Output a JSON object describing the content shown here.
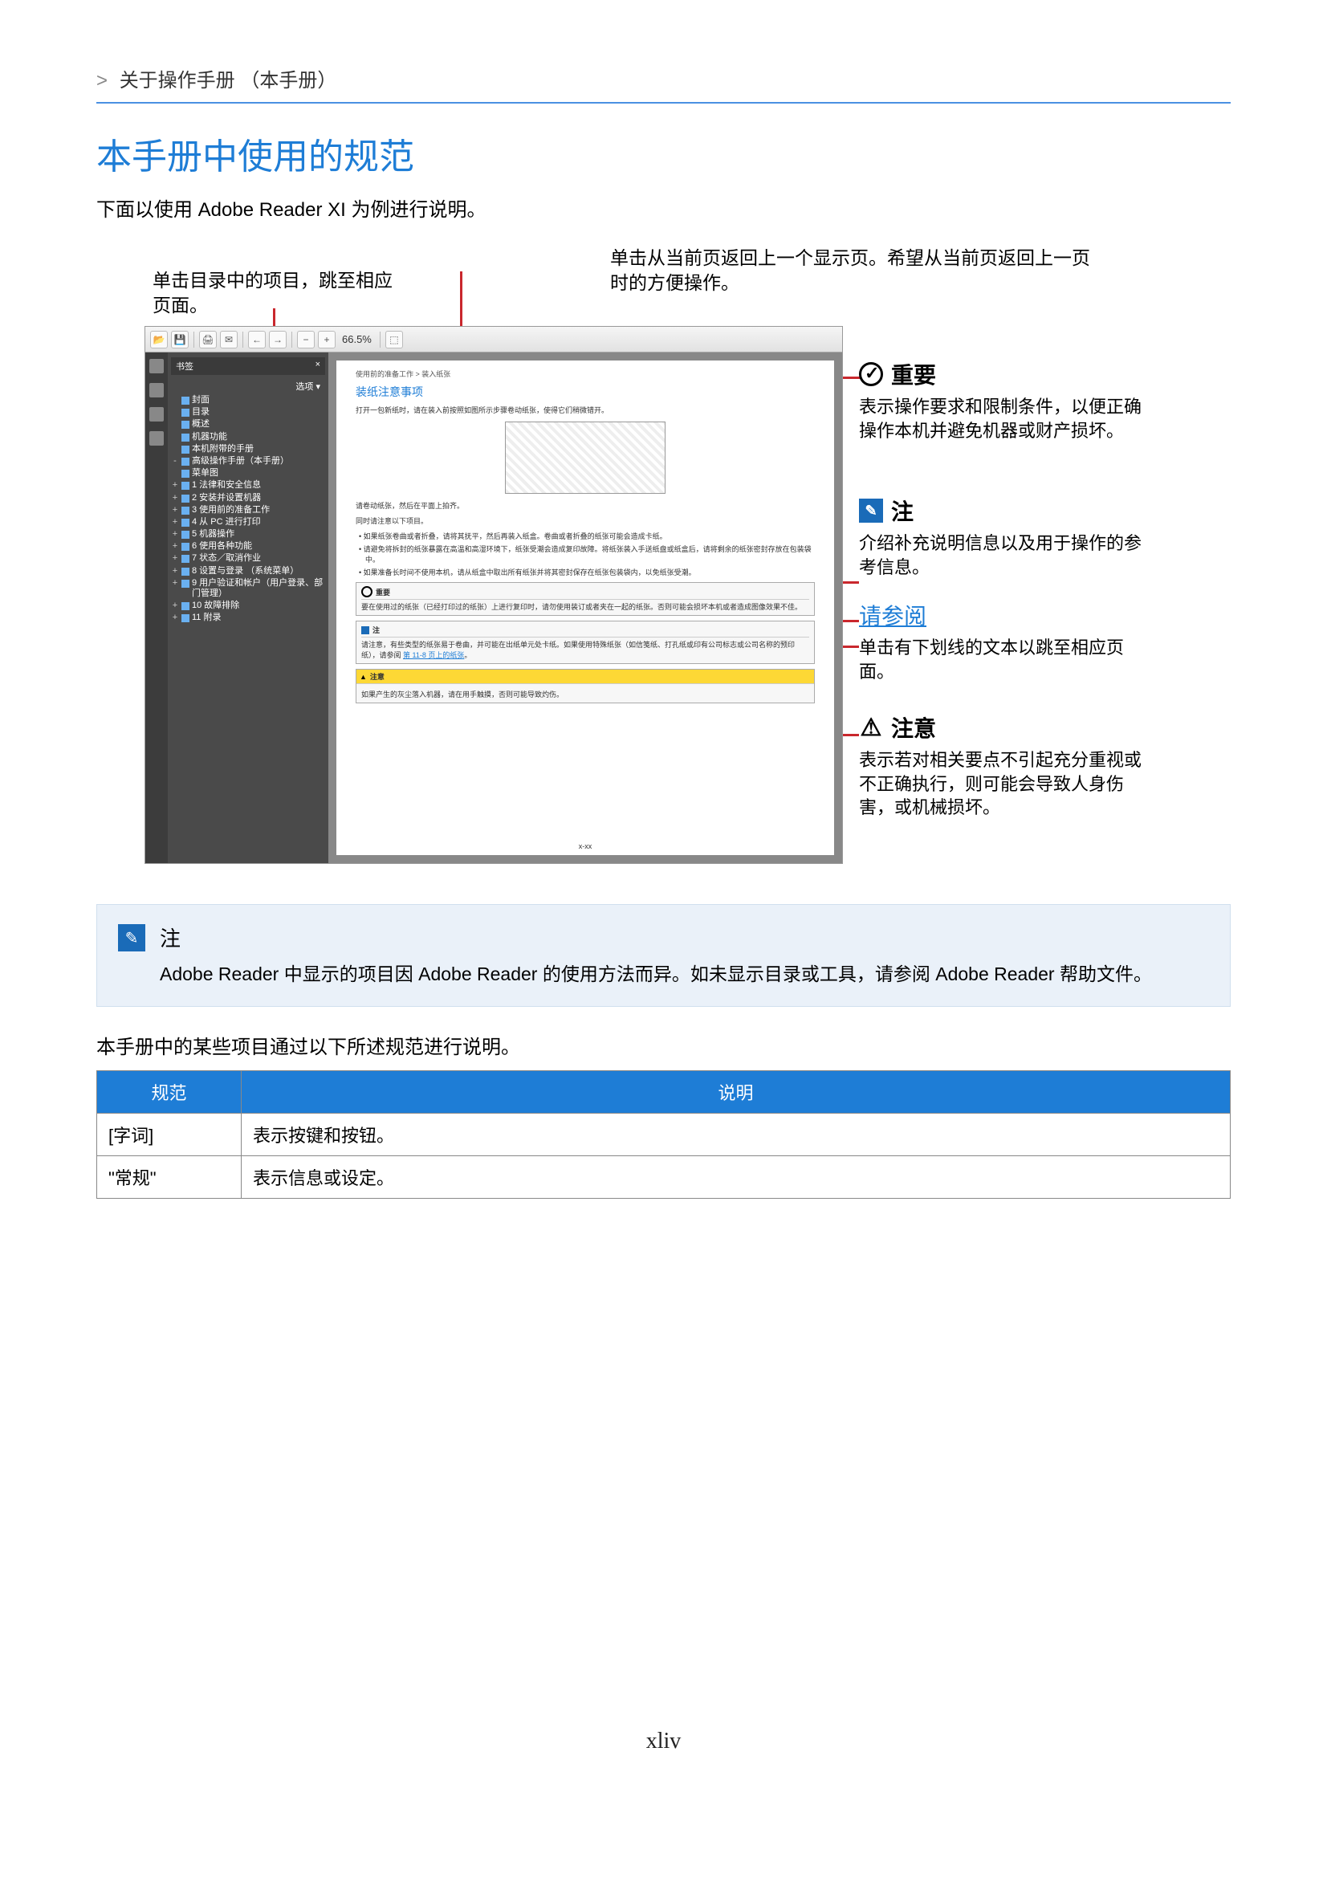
{
  "breadcrumb": {
    "caret": ">",
    "text": "关于操作手册 （本手册）"
  },
  "title": "本手册中使用的规范",
  "intro": "下面以使用 Adobe Reader XI 为例进行说明。",
  "callouts": {
    "left_top": "单击目录中的项目，跳至相应页面。",
    "right_top": "单击从当前页返回上一个显示页。希望从当前页返回上一页时的方便操作。"
  },
  "reader": {
    "zoom": "66.5%",
    "bookmark_hdr": "书签",
    "bookmark_opts": "选项 ▾",
    "bookmarks": [
      {
        "pm": "",
        "label": "封面"
      },
      {
        "pm": "",
        "label": "目录"
      },
      {
        "pm": "",
        "label": "概述"
      },
      {
        "pm": "",
        "label": "机器功能"
      },
      {
        "pm": "",
        "label": "本机附带的手册"
      },
      {
        "pm": "-",
        "label": "高级操作手册（本手册）"
      },
      {
        "pm": "",
        "label": "菜单图"
      },
      {
        "pm": "+",
        "label": "1 法律和安全信息"
      },
      {
        "pm": "+",
        "label": "2 安装并设置机器"
      },
      {
        "pm": "+",
        "label": "3 使用前的准备工作"
      },
      {
        "pm": "+",
        "label": "4 从 PC 进行打印"
      },
      {
        "pm": "+",
        "label": "5 机器操作"
      },
      {
        "pm": "+",
        "label": "6 使用各种功能"
      },
      {
        "pm": "+",
        "label": "7 状态／取消作业"
      },
      {
        "pm": "+",
        "label": "8 设置与登录 （系统菜单）"
      },
      {
        "pm": "+",
        "label": "9 用户验证和帐户（用户登录、部门管理）"
      },
      {
        "pm": "+",
        "label": "10 故障排除"
      },
      {
        "pm": "+",
        "label": "11 附录"
      }
    ],
    "doc": {
      "breadcrumb": "使用前的准备工作 > 装入纸张",
      "title": "装纸注意事项",
      "sub": "打开一包新纸时，请在装入前按照如图所示步骤卷动纸张，使得它们稍微错开。",
      "small1": "请卷动纸张，然后在平面上拍齐。",
      "small2": "同时请注意以下项目。",
      "b1": "如果纸张卷曲或者折叠，请将其抚平，然后再装入纸盒。卷曲或者折叠的纸张可能会造成卡纸。",
      "b2": "请避免将拆封的纸张暴露在高温和高湿环境下，纸张受潮会造成复印故障。将纸张装入手送纸盘或纸盒后，请将剩余的纸张密封存放在包装袋中。",
      "b3": "如果准备长时间不使用本机，请从纸盒中取出所有纸张并将其密封保存在纸张包装袋内，以免纸张受潮。",
      "imp_hdr": "重要",
      "imp_body": "要在使用过的纸张（已经打印过的纸张）上进行复印时，请勿使用装订或者夹在一起的纸张。否则可能会损坏本机或者造成图像效果不佳。",
      "note_hdr": "注",
      "note_body": "请注意，有些类型的纸张易于卷曲，并可能在出纸单元处卡纸。如果使用特殊纸张（如信笺纸、打孔纸或印有公司标志或公司名称的预印纸），请参阅",
      "note_link": "第 11-8 页上的纸张",
      "caution_hdr": "注意",
      "caution_body": "如果产生的灰尘落入机器，请在用手触摸，否则可能导致灼伤。",
      "pgnum": "x-xx"
    }
  },
  "annotations": {
    "important": {
      "title": "重要",
      "desc": "表示操作要求和限制条件，以便正确操作本机并避免机器或财产损坏。"
    },
    "note": {
      "title": "注",
      "desc": "介绍补充说明信息以及用于操作的参考信息。"
    },
    "reference": {
      "title": "请参阅",
      "desc": "单击有下划线的文本以跳至相应页面。"
    },
    "caution": {
      "title": "注意",
      "desc": "表示若对相关要点不引起充分重视或不正确执行，则可能会导致人身伤害，或机械损坏。"
    }
  },
  "note_section": {
    "title": "注",
    "body": "Adobe Reader 中显示的项目因 Adobe Reader 的使用方法而异。如未显示目录或工具，请参阅 Adobe Reader 帮助文件。"
  },
  "table_intro": "本手册中的某些项目通过以下所述规范进行说明。",
  "table": {
    "headers": {
      "c1": "规范",
      "c2": "说明"
    },
    "rows": [
      {
        "c1": "[字词]",
        "c2": "表示按键和按钮。"
      },
      {
        "c1": "\"常规\"",
        "c2": "表示信息或设定。"
      }
    ]
  },
  "page_number": "xliv"
}
